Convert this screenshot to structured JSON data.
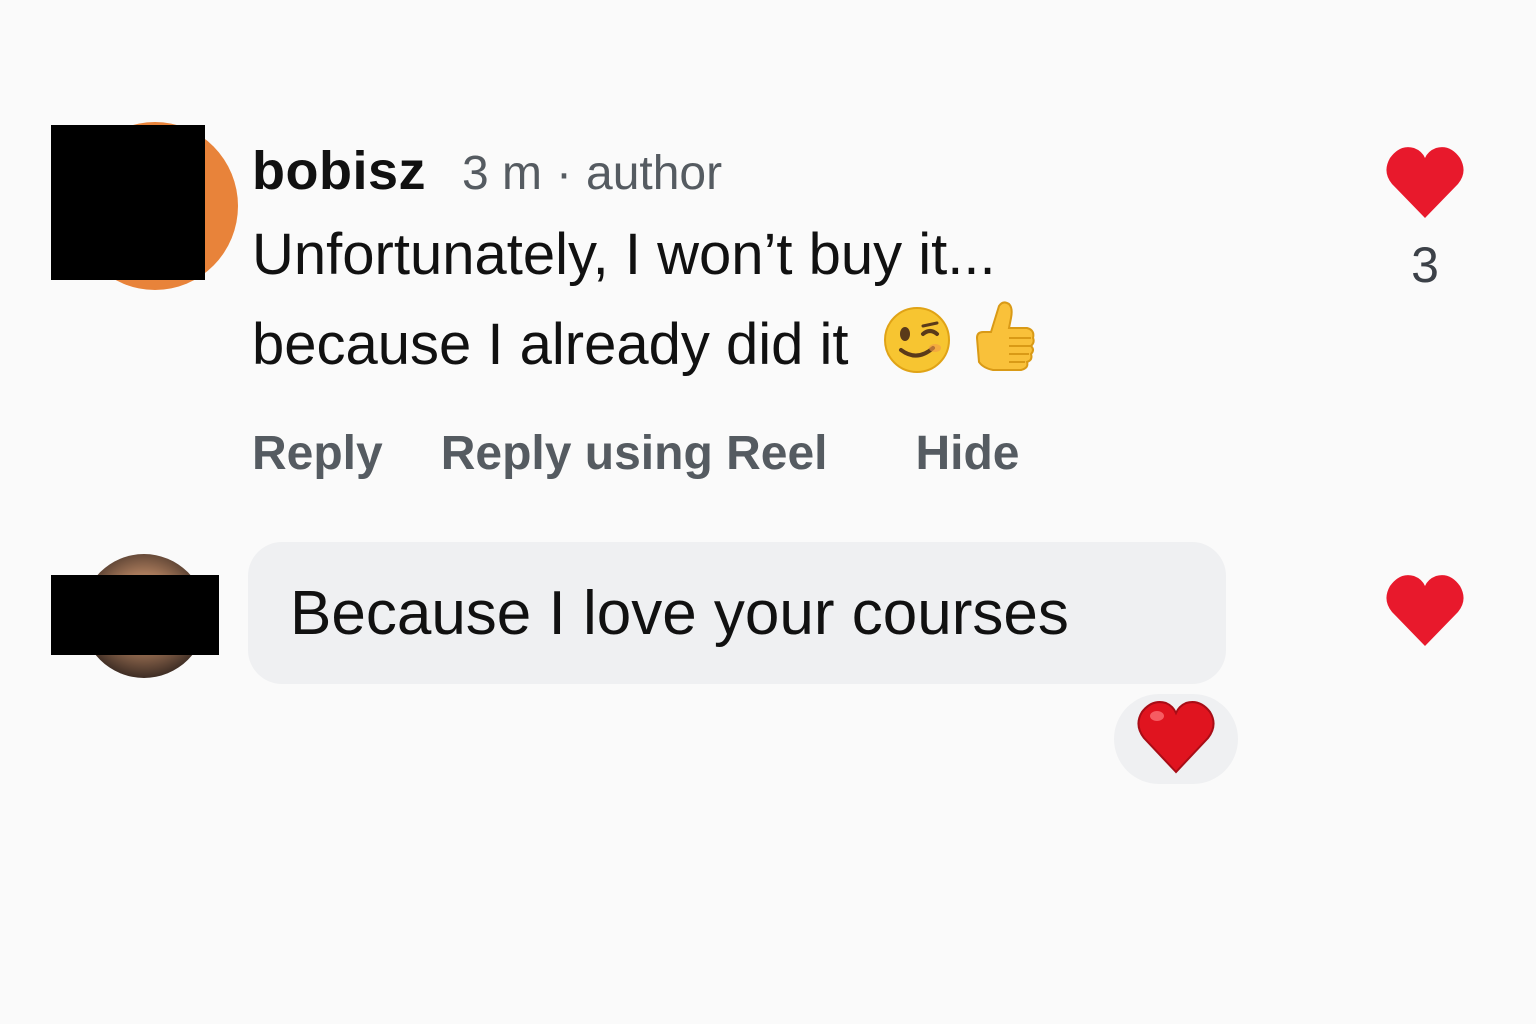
{
  "colors": {
    "background": "#fafafa",
    "heart_red": "#e8192c",
    "secondary_text": "#555b61",
    "bubble_bg": "#eff0f2"
  },
  "comment": {
    "username": "bobisz",
    "timestamp": "3 m",
    "separator": "·",
    "role": "author",
    "text_line1": "Unfortunately, I won’t buy it...",
    "text_line2": "because I already did it",
    "emojis": [
      "winking-face-emoji",
      "thumbs-up-emoji"
    ],
    "like_icon": "heart-icon",
    "like_count": "3",
    "actions": {
      "reply": "Reply",
      "reply_reel": "Reply using Reel",
      "hide": "Hide"
    }
  },
  "reply": {
    "text": "Because I love your courses",
    "like_icon": "heart-icon",
    "reaction": "red-heart-emoji"
  }
}
